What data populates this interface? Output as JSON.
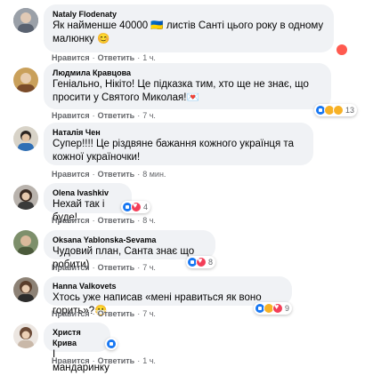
{
  "comments": [
    {
      "author": "Nataly Flodenaty",
      "text": "Як найменше 40000 🇺🇦 листів Санті цього року в одному малюнку 😊",
      "like": "Нравится",
      "reply": "Ответить",
      "time": "1 ч.",
      "reaction_count": ""
    },
    {
      "author": "Людмила Кравцова",
      "text": "Геніально, Нікіто! Це підказка тим, хто ще не знає, що просити у Святого Миколая!💌",
      "like": "Нравится",
      "reply": "Ответить",
      "time": "7 ч.",
      "reaction_count": "13"
    },
    {
      "author": "Наталія Чен",
      "text": "Супер!!!! Це різдвяне бажання кожного українця та кожної україночки!",
      "like": "Нравится",
      "reply": "Ответить",
      "time": "8 мин.",
      "reaction_count": ""
    },
    {
      "author": "Olena Ivashkiv",
      "text": "Нехай так і буде!",
      "like": "Нравится",
      "reply": "Ответить",
      "time": "8 ч.",
      "reaction_count": "4"
    },
    {
      "author": "Oksana Yablonska-Sevama",
      "text": "Чудовий план, Санта знає що робити)",
      "like": "Нравится",
      "reply": "Ответить",
      "time": "7 ч.",
      "reaction_count": "8"
    },
    {
      "author": "Hanna Valkovets",
      "text": "Хтось уже написав «мені нравиться як воно горить»?😷",
      "like": "Нравится",
      "reply": "Ответить",
      "time": "7 ч.",
      "reaction_count": "9"
    },
    {
      "author": "Христя Крива",
      "text": "І мандаринку",
      "like": "Нравится",
      "reply": "Ответить",
      "time": "1 ч.",
      "reaction_count": ""
    }
  ],
  "colors": {
    "bubble": "#f0f2f5",
    "meta": "#65676b",
    "like_blue": "#1877f2",
    "love_red": "#f33e58",
    "emoji_yellow": "#f7b928"
  }
}
